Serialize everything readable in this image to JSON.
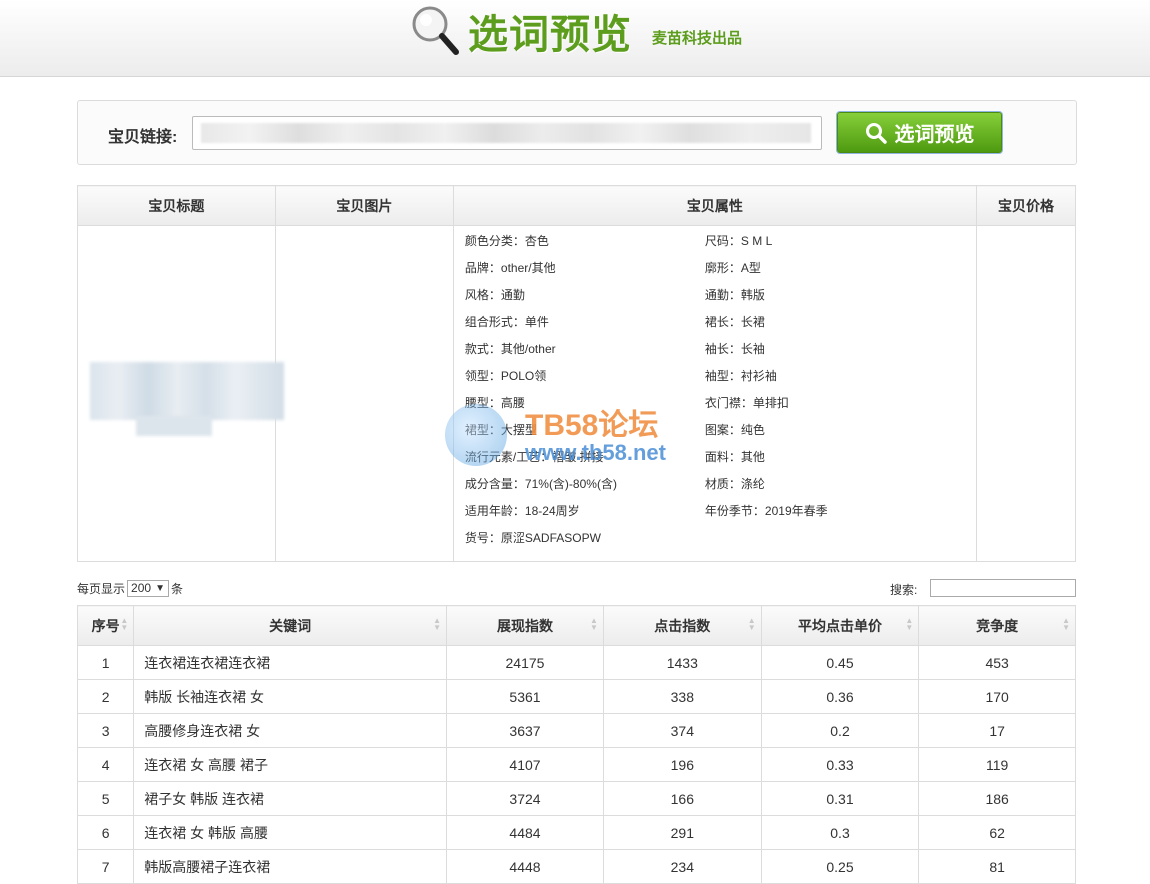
{
  "header": {
    "title": "选词预览",
    "subtitle": "麦苗科技出品"
  },
  "search": {
    "label": "宝贝链接:",
    "button_label": "选词预览",
    "url_value": ""
  },
  "product": {
    "headers": [
      "宝贝标题",
      "宝贝图片",
      "宝贝属性",
      "宝贝价格"
    ],
    "attributes": [
      "颜色分类：杏色",
      "尺码：S M L",
      "品牌：other/其他",
      "廓形：A型",
      "风格：通勤",
      "通勤：韩版",
      "组合形式：单件",
      "裙长：长裙",
      "款式：其他/other",
      "袖长：长袖",
      "领型：POLO领",
      "袖型：衬衫袖",
      "腰型：高腰",
      "衣门襟：单排扣",
      "裙型：大摆型",
      "图案：纯色",
      "流行元素/工艺：褶皱 拼接",
      "面料：其他",
      "成分含量：71%(含)-80%(含)",
      "材质：涤纶",
      "适用年龄：18-24周岁",
      "年份季节：2019年春季",
      "货号：原涩SADFASOPW"
    ]
  },
  "watermark": {
    "line1": "TB58论坛",
    "line2": "www.tb58.net"
  },
  "controls": {
    "page_size_prefix": "每页显示",
    "page_size_value": "200",
    "page_size_suffix": "条",
    "search_label": "搜索:"
  },
  "keywords": {
    "headers": [
      "序号",
      "关键词",
      "展现指数",
      "点击指数",
      "平均点击单价",
      "竞争度"
    ],
    "rows": [
      {
        "no": "1",
        "keyword": "连衣裙连衣裙连衣裙",
        "impressions": "24175",
        "clicks": "1433",
        "cpc": "0.45",
        "competition": "453"
      },
      {
        "no": "2",
        "keyword": "韩版 长袖连衣裙 女",
        "impressions": "5361",
        "clicks": "338",
        "cpc": "0.36",
        "competition": "170"
      },
      {
        "no": "3",
        "keyword": "高腰修身连衣裙 女",
        "impressions": "3637",
        "clicks": "374",
        "cpc": "0.2",
        "competition": "17"
      },
      {
        "no": "4",
        "keyword": "连衣裙 女 高腰 裙子",
        "impressions": "4107",
        "clicks": "196",
        "cpc": "0.33",
        "competition": "119"
      },
      {
        "no": "5",
        "keyword": "裙子女 韩版 连衣裙",
        "impressions": "3724",
        "clicks": "166",
        "cpc": "0.31",
        "competition": "186"
      },
      {
        "no": "6",
        "keyword": "连衣裙 女 韩版 高腰",
        "impressions": "4484",
        "clicks": "291",
        "cpc": "0.3",
        "competition": "62"
      },
      {
        "no": "7",
        "keyword": "韩版高腰裙子连衣裙",
        "impressions": "4448",
        "clicks": "234",
        "cpc": "0.25",
        "competition": "81"
      }
    ]
  }
}
